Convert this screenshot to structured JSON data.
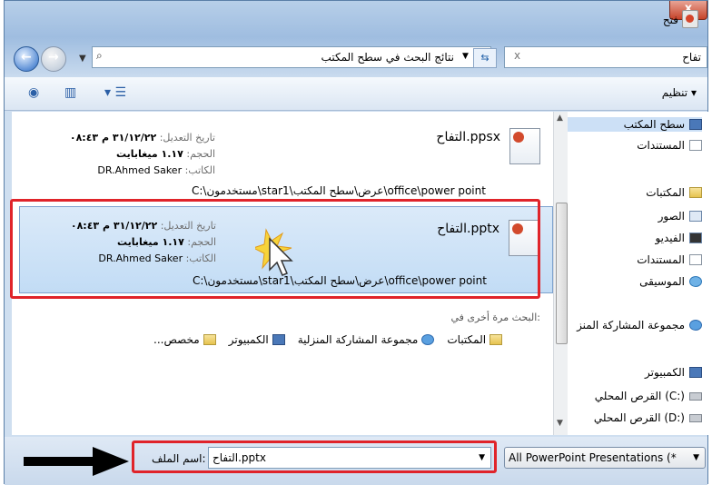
{
  "window": {
    "title": "فتح",
    "close_label": "x"
  },
  "address": {
    "left_glyph": "◀",
    "path_text": "نتائج البحث في سطح المكتب",
    "refresh_glyph": "⇆",
    "search_value": "تفاح",
    "search_clear": "x"
  },
  "toolbar": {
    "organize": "تنظيم ▾"
  },
  "results": [
    {
      "name": "التفاح.ppsx",
      "modified_label": "تاريخ التعديل:",
      "modified": "٣١/١٢/٢٢ م ٠٨:٤٣",
      "size_label": "الحجم:",
      "size": "١.١٧ ميغابايت",
      "author_label": "الكاتب:",
      "author": "DR.Ahmed Saker",
      "path": "C:\\مستخدمون\\star1\\عرض\\سطح المكتب\\office\\power point"
    },
    {
      "name": "التفاح.pptx",
      "modified_label": "تاريخ التعديل:",
      "modified": "٣١/١٢/٢٢ م ٠٨:٤٣",
      "size_label": "الحجم:",
      "size": "١.١٧ ميغابايت",
      "author_label": "الكاتب:",
      "author": "DR.Ahmed Saker",
      "path": "C:\\مستخدمون\\star1\\عرض\\سطح المكتب\\office\\power point"
    }
  ],
  "search_again": {
    "heading": "البحث مرة أخرى في:",
    "links": [
      "المكتبات",
      "مجموعة المشاركة المنزلية",
      "الكمبيوتر",
      "مخصص..."
    ]
  },
  "nav": {
    "items": [
      {
        "label": "سطح المكتب",
        "icon": "desktop-icon"
      },
      {
        "label": "المستندات",
        "icon": "documents-icon"
      },
      {
        "label": "المكتبات",
        "icon": "libraries-icon"
      },
      {
        "label": "الصور",
        "icon": "pictures-icon"
      },
      {
        "label": "الفيديو",
        "icon": "video-icon"
      },
      {
        "label": "المستندات",
        "icon": "documents-icon"
      },
      {
        "label": "الموسيقى",
        "icon": "music-icon"
      },
      {
        "label": "مجموعة المشاركة المنز",
        "icon": "homegroup-icon"
      },
      {
        "label": "الكمبيوتر",
        "icon": "computer-icon"
      },
      {
        "label": "القرص المحلي (C:)",
        "icon": "drive-icon"
      },
      {
        "label": "القرص المحلي (D:)",
        "icon": "drive-icon"
      }
    ]
  },
  "bottom": {
    "filename_label": "اسم الملف:",
    "filename_value": "التفاح.pptx",
    "filetype_value": "All PowerPoint Presentations (*"
  },
  "colors": {
    "highlight": "#e0242a",
    "selection": "#c2dcf5"
  }
}
